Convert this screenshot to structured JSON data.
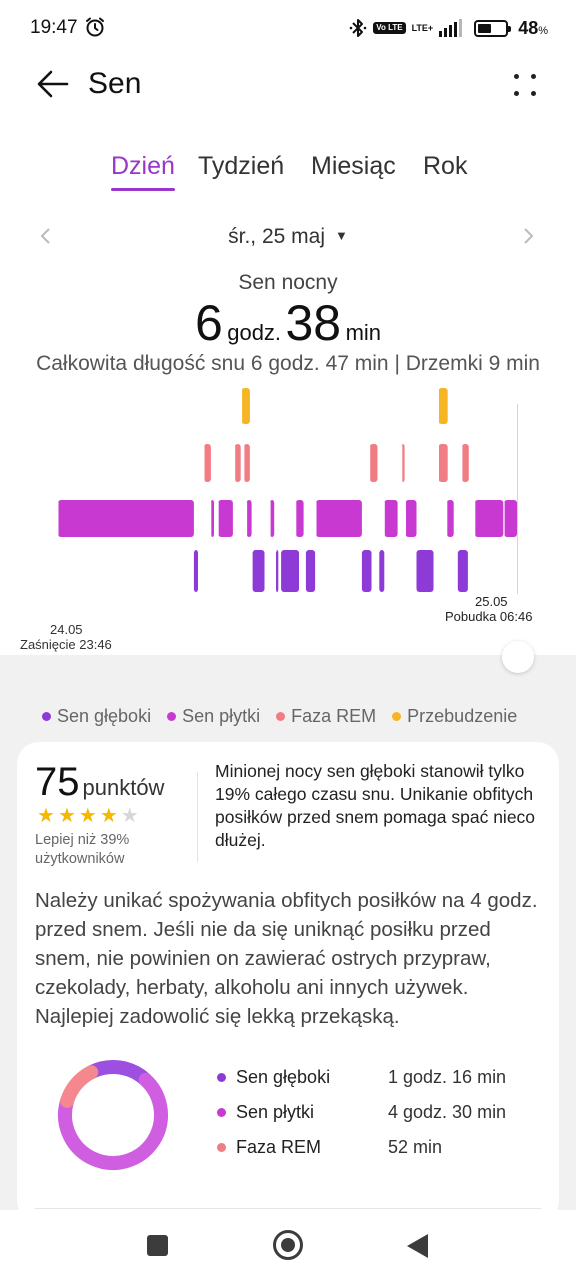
{
  "status_bar": {
    "time": "19:47",
    "icons": [
      "alarm-icon",
      "bluetooth-icon",
      "volte-icon",
      "lte-icon",
      "signal-icon",
      "battery-icon"
    ],
    "volte_label": "Vo LTE",
    "network_label": "LTE+",
    "signal_bars_filled": 4,
    "battery_level": 0.48,
    "battery_percent": "48",
    "battery_percent_sign": "%"
  },
  "header": {
    "title": "Sen",
    "back_icon": "arrow-left-icon",
    "menu_icon": "more-dots-icon"
  },
  "tabs": [
    {
      "label": "Dzień",
      "active": true
    },
    {
      "label": "Tydzień",
      "active": false
    },
    {
      "label": "Miesiąc",
      "active": false
    },
    {
      "label": "Rok",
      "active": false
    }
  ],
  "date_selector": {
    "label": "śr., 25 maj",
    "caret": "▼"
  },
  "night_sleep": {
    "label": "Sen nocny",
    "hours": "6",
    "hours_unit": "godz.",
    "minutes": "38",
    "minutes_unit": "min",
    "total_line": "Całkowita długość snu 6 godz. 47 min | Drzemki 9 min"
  },
  "chart_data": {
    "type": "bar",
    "title": "",
    "x_start": {
      "date": "24.05",
      "label": "Zaśnięcie 23:46"
    },
    "x_end": {
      "date": "25.05",
      "label": "Pobudka 06:46"
    },
    "levels": [
      "Przebudzenie",
      "Faza REM",
      "Sen płytki",
      "Sen głęboki"
    ],
    "colors": {
      "Przebudzenie": "#f6b523",
      "Faza REM": "#f07d84",
      "Sen płytki": "#c839d2",
      "Sen głęboki": "#8e3ad6"
    },
    "segments": [
      {
        "stage": "Sen płytki",
        "start": 0.0,
        "end": 0.296
      },
      {
        "stage": "Sen głęboki",
        "start": 0.296,
        "end": 0.305
      },
      {
        "stage": "Faza REM",
        "start": 0.318,
        "end": 0.333
      },
      {
        "stage": "Sen płytki",
        "start": 0.333,
        "end": 0.34
      },
      {
        "stage": "Sen płytki",
        "start": 0.349,
        "end": 0.381
      },
      {
        "stage": "Faza REM",
        "start": 0.385,
        "end": 0.398
      },
      {
        "stage": "Przebudzenie",
        "start": 0.4,
        "end": 0.418
      },
      {
        "stage": "Faza REM",
        "start": 0.405,
        "end": 0.418
      },
      {
        "stage": "Sen płytki",
        "start": 0.411,
        "end": 0.422
      },
      {
        "stage": "Sen głęboki",
        "start": 0.424,
        "end": 0.45
      },
      {
        "stage": "Sen płytki",
        "start": 0.462,
        "end": 0.471
      },
      {
        "stage": "Sen głęboki",
        "start": 0.475,
        "end": 0.48
      },
      {
        "stage": "Sen głęboki",
        "start": 0.486,
        "end": 0.525
      },
      {
        "stage": "Sen płytki",
        "start": 0.518,
        "end": 0.535
      },
      {
        "stage": "Sen głęboki",
        "start": 0.54,
        "end": 0.56
      },
      {
        "stage": "Sen płytki",
        "start": 0.562,
        "end": 0.662
      },
      {
        "stage": "Sen głęboki",
        "start": 0.662,
        "end": 0.683
      },
      {
        "stage": "Faza REM",
        "start": 0.679,
        "end": 0.696
      },
      {
        "stage": "Sen głęboki",
        "start": 0.7,
        "end": 0.711
      },
      {
        "stage": "Sen płytki",
        "start": 0.711,
        "end": 0.74
      },
      {
        "stage": "Faza REM",
        "start": 0.749,
        "end": 0.755
      },
      {
        "stage": "Sen płytki",
        "start": 0.757,
        "end": 0.781
      },
      {
        "stage": "Sen głęboki",
        "start": 0.781,
        "end": 0.818
      },
      {
        "stage": "Przebudzenie",
        "start": 0.829,
        "end": 0.849
      },
      {
        "stage": "Faza REM",
        "start": 0.829,
        "end": 0.849
      },
      {
        "stage": "Sen płytki",
        "start": 0.847,
        "end": 0.862
      },
      {
        "stage": "Sen głęboki",
        "start": 0.871,
        "end": 0.893
      },
      {
        "stage": "Faza REM",
        "start": 0.88,
        "end": 0.895
      },
      {
        "stage": "Sen płytki",
        "start": 0.908,
        "end": 0.97
      },
      {
        "stage": "Sen płytki",
        "start": 0.972,
        "end": 1.0
      }
    ]
  },
  "legend": [
    {
      "label": "Sen głęboki",
      "color": "#8e3ad6"
    },
    {
      "label": "Sen płytki",
      "color": "#c839d2"
    },
    {
      "label": "Faza REM",
      "color": "#f07d84"
    },
    {
      "label": "Przebudzenie",
      "color": "#f6b523"
    }
  ],
  "score": {
    "value": "75",
    "unit": "punktów",
    "stars_filled": 4,
    "stars_total": 5,
    "comparison": "Lepiej niż 39% użytkowników"
  },
  "summary": "Minionej nocy sen głęboki stanowił tylko 19% całego czasu snu. Unikanie obfitych posiłków przed snem pomaga spać nieco dłużej.",
  "advice": "Należy unikać spożywania obfitych posiłków na 4 godz. przed snem. Jeśli nie da się uniknąć posiłku przed snem, nie powinien on zawierać ostrych przypraw, czekolady, herbaty, alkoholu ani innych używek. Najlepiej zadowolić się lekką przekąską.",
  "stages": [
    {
      "label": "Sen głęboki",
      "value": "1 godz. 16 min",
      "minutes": 76,
      "color": "#8e3ad6"
    },
    {
      "label": "Sen płytki",
      "value": "4 godz. 30 min",
      "minutes": 270,
      "color": "#c839d2"
    },
    {
      "label": "Faza REM",
      "value": "52 min",
      "minutes": 52,
      "color": "#f07d84"
    }
  ],
  "navbar": {
    "icons": [
      "recent-apps-icon",
      "home-icon",
      "back-icon"
    ]
  }
}
